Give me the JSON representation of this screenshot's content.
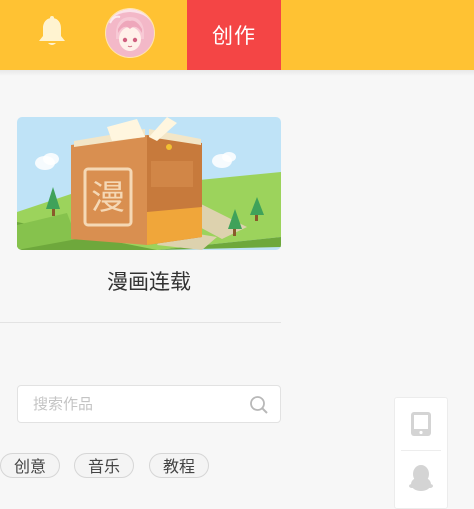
{
  "header": {
    "create_label": "创作"
  },
  "card": {
    "cover_glyph": "漫",
    "title": "漫画连载"
  },
  "search": {
    "placeholder": "搜索作品"
  },
  "tags": [
    "创意",
    "音乐",
    "教程"
  ],
  "icons": {
    "bell": "bell-icon",
    "avatar": "avatar",
    "search": "search-icon",
    "phone": "phone-icon",
    "qq": "qq-penguin-icon"
  },
  "colors": {
    "topbar": "#ffc233",
    "create_button": "#f44545",
    "page_background": "#f7f7f7"
  }
}
